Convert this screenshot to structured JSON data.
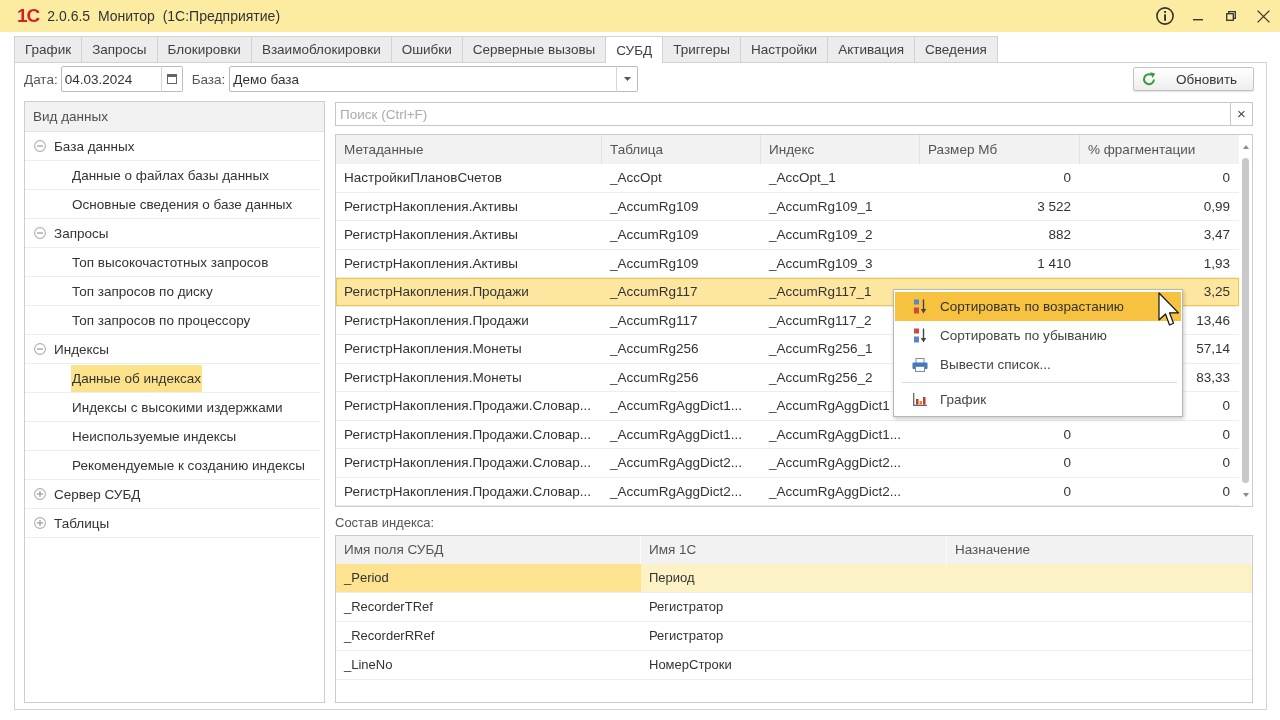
{
  "window": {
    "logo": "1С",
    "title": "2.0.6.5  Монитор  (1С:Предприятие)"
  },
  "tabs": [
    {
      "label": "График",
      "selected": false
    },
    {
      "label": "Запросы",
      "selected": false
    },
    {
      "label": "Блокировки",
      "selected": false
    },
    {
      "label": "Взаимоблокировки",
      "selected": false
    },
    {
      "label": "Ошибки",
      "selected": false
    },
    {
      "label": "Серверные вызовы",
      "selected": false
    },
    {
      "label": "СУБД",
      "selected": true
    },
    {
      "label": "Триггеры",
      "selected": false
    },
    {
      "label": "Настройки",
      "selected": false
    },
    {
      "label": "Активация",
      "selected": false
    },
    {
      "label": "Сведения",
      "selected": false
    }
  ],
  "toolbar": {
    "date_label": "Дата:",
    "date_value": "04.03.2024",
    "base_label": "База:",
    "base_value": "Демо база",
    "refresh_button": "Обновить"
  },
  "sidebar": {
    "header": "Вид данных",
    "items": [
      {
        "label": "База данных",
        "expanded": true,
        "selected": false,
        "children": [
          {
            "label": "Данные о файлах базы данных",
            "selected": false
          },
          {
            "label": "Основные сведения о базе данных",
            "selected": false
          }
        ]
      },
      {
        "label": "Запросы",
        "expanded": true,
        "selected": false,
        "children": [
          {
            "label": "Топ высокочастотных запросов",
            "selected": false
          },
          {
            "label": "Топ запросов по диску",
            "selected": false
          },
          {
            "label": "Топ запросов по процессору",
            "selected": false
          }
        ]
      },
      {
        "label": "Индексы",
        "expanded": true,
        "selected": false,
        "children": [
          {
            "label": "Данные об индексах",
            "selected": true
          },
          {
            "label": "Индексы с высокими издержками",
            "selected": false
          },
          {
            "label": "Неиспользуемые индексы",
            "selected": false
          },
          {
            "label": "Рекомендуемые к созданию индексы",
            "selected": false
          }
        ]
      },
      {
        "label": "Сервер СУБД",
        "expanded": false,
        "selected": false
      },
      {
        "label": "Таблицы",
        "expanded": false,
        "selected": false
      }
    ]
  },
  "search": {
    "placeholder": "Поиск (Ctrl+F)",
    "clear_button": "×"
  },
  "table": {
    "columns": [
      "Метаданные",
      "Таблица",
      "Индекс",
      "Размер Мб",
      "% фрагментации"
    ],
    "rows": [
      {
        "metadata": "НастройкиПлановСчетов",
        "table": "_AccOpt",
        "index": "_AccOpt_1",
        "size": "0",
        "fragmentation": "0",
        "selected": false
      },
      {
        "metadata": "РегистрНакопления.Активы",
        "table": "_AccumRg109",
        "index": "_AccumRg109_1",
        "size": "3 522",
        "fragmentation": "0,99",
        "selected": false
      },
      {
        "metadata": "РегистрНакопления.Активы",
        "table": "_AccumRg109",
        "index": "_AccumRg109_2",
        "size": "882",
        "fragmentation": "3,47",
        "selected": false
      },
      {
        "metadata": "РегистрНакопления.Активы",
        "table": "_AccumRg109",
        "index": "_AccumRg109_3",
        "size": "1 410",
        "fragmentation": "1,93",
        "selected": false
      },
      {
        "metadata": "РегистрНакопления.Продажи",
        "table": "_AccumRg117",
        "index": "_AccumRg117_1",
        "fragmentation": "3,25",
        "selected": true
      },
      {
        "metadata": "РегистрНакопления.Продажи",
        "table": "_AccumRg117",
        "index": "_AccumRg117_2",
        "fragmentation": "13,46",
        "selected": false
      },
      {
        "metadata": "РегистрНакопления.Монеты",
        "table": "_AccumRg256",
        "index": "_AccumRg256_1",
        "fragmentation": "57,14",
        "selected": false
      },
      {
        "metadata": "РегистрНакопления.Монеты",
        "table": "_AccumRg256",
        "index": "_AccumRg256_2",
        "fragmentation": "83,33",
        "selected": false
      },
      {
        "metadata": "РегистрНакопления.Продажи.Словар...",
        "table": "_AccumRgAggDict1...",
        "index": "_AccumRgAggDict1",
        "fragmentation": "0",
        "selected": false
      },
      {
        "metadata": "РегистрНакопления.Продажи.Словар...",
        "table": "_AccumRgAggDict1...",
        "index": "_AccumRgAggDict1...",
        "size": "0",
        "fragmentation": "0",
        "selected": false
      },
      {
        "metadata": "РегистрНакопления.Продажи.Словар...",
        "table": "_AccumRgAggDict2...",
        "index": "_AccumRgAggDict2...",
        "size": "0",
        "fragmentation": "0",
        "selected": false
      },
      {
        "metadata": "РегистрНакопления.Продажи.Словар...",
        "table": "_AccumRgAggDict2...",
        "index": "_AccumRgAggDict2...",
        "size": "0",
        "fragmentation": "0",
        "selected": false
      }
    ]
  },
  "context_menu": {
    "groups": [
      [
        {
          "label": "Сортировать по возрастанию",
          "selected": true
        },
        {
          "label": "Сортировать по убыванию",
          "selected": false
        },
        {
          "label": "Вывести список...",
          "selected": false
        }
      ],
      [
        {
          "label": "График",
          "selected": false
        }
      ]
    ]
  },
  "index_composition": {
    "label": "Состав индекса:",
    "columns": [
      "Имя поля СУБД",
      "Имя 1С",
      "Назначение"
    ],
    "rows": [
      {
        "field": "_Period",
        "name_1c": "Период",
        "selected": true
      },
      {
        "field": "_RecorderTRef",
        "name_1c": "Регистратор",
        "selected": false
      },
      {
        "field": "_RecorderRRef",
        "name_1c": "Регистратор",
        "selected": false
      },
      {
        "field": "_LineNo",
        "name_1c": "НомерСтроки",
        "selected": false
      }
    ]
  }
}
